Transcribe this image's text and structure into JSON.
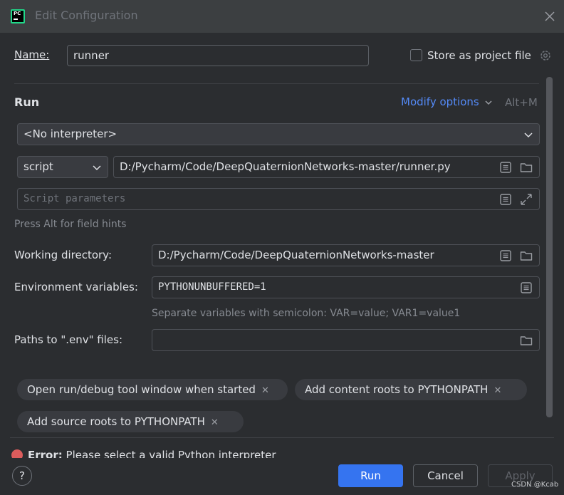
{
  "window": {
    "title": "Edit Configuration"
  },
  "name": {
    "label": "Name:",
    "value": "runner"
  },
  "store_project": {
    "label": "Store as project file"
  },
  "run": {
    "section_title": "Run",
    "modify_options": "Modify options",
    "modify_shortcut": "Alt+M",
    "interpreter": "<No interpreter>",
    "mode": "script",
    "script_path": "D:/Pycharm/Code/DeepQuaternionNetworks-master/runner.py",
    "script_params_placeholder": "Script parameters",
    "field_hint": "Press Alt for field hints"
  },
  "working_dir": {
    "label": "Working directory:",
    "value": "D:/Pycharm/Code/DeepQuaternionNetworks-master"
  },
  "env_vars": {
    "label": "Environment variables:",
    "value": "PYTHONUNBUFFERED=1",
    "hint": "Separate variables with semicolon: VAR=value; VAR1=value1"
  },
  "env_files": {
    "label": "Paths to \".env\" files:",
    "value": ""
  },
  "chips": [
    {
      "label": "Open run/debug tool window when started"
    },
    {
      "label": "Add content roots to PYTHONPATH"
    },
    {
      "label": "Add source roots to PYTHONPATH"
    }
  ],
  "error": {
    "prefix": "Error:",
    "message": "Please select a valid Python interpreter"
  },
  "footer": {
    "help": "?",
    "run": "Run",
    "cancel": "Cancel",
    "apply": "Apply"
  },
  "watermark": "CSDN @Kcab",
  "colors": {
    "accent": "#3574f0",
    "link": "#548af7",
    "error": "#db5c5c",
    "bg": "#2b2d30"
  }
}
